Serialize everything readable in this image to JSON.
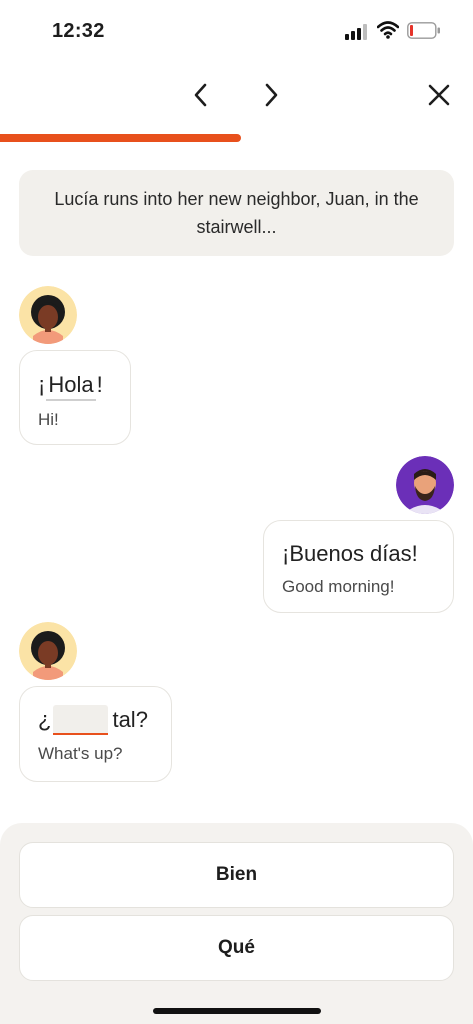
{
  "status": {
    "time": "12:32"
  },
  "lesson": {
    "progress": 0.51
  },
  "intro": {
    "text": "Lucía runs into her new neighbor, Juan, in the stairwell..."
  },
  "messages": {
    "m1": {
      "speaker": "Lucía",
      "open": "¡",
      "word": "Hola",
      "close": "!",
      "translation": "Hi!"
    },
    "m2": {
      "speaker": "Juan",
      "text": "¡Buenos días!",
      "translation": "Good morning!"
    },
    "m3": {
      "speaker": "Lucía",
      "open": "¿",
      "after": "tal?",
      "translation": "What's up?"
    }
  },
  "options": [
    "Bien",
    "Qué"
  ],
  "icons": {
    "prev": "chevron-left-icon",
    "next": "chevron-right-icon",
    "close": "close-icon",
    "signal": "cellular-signal-icon",
    "wifi": "wifi-icon",
    "battery": "battery-low-icon"
  },
  "colors": {
    "accent": "#e8501c",
    "battery_low": "#e5332a",
    "juan_avatar_bg": "#6b2fb8",
    "lucia_avatar_bg": "#fbe3a6"
  }
}
